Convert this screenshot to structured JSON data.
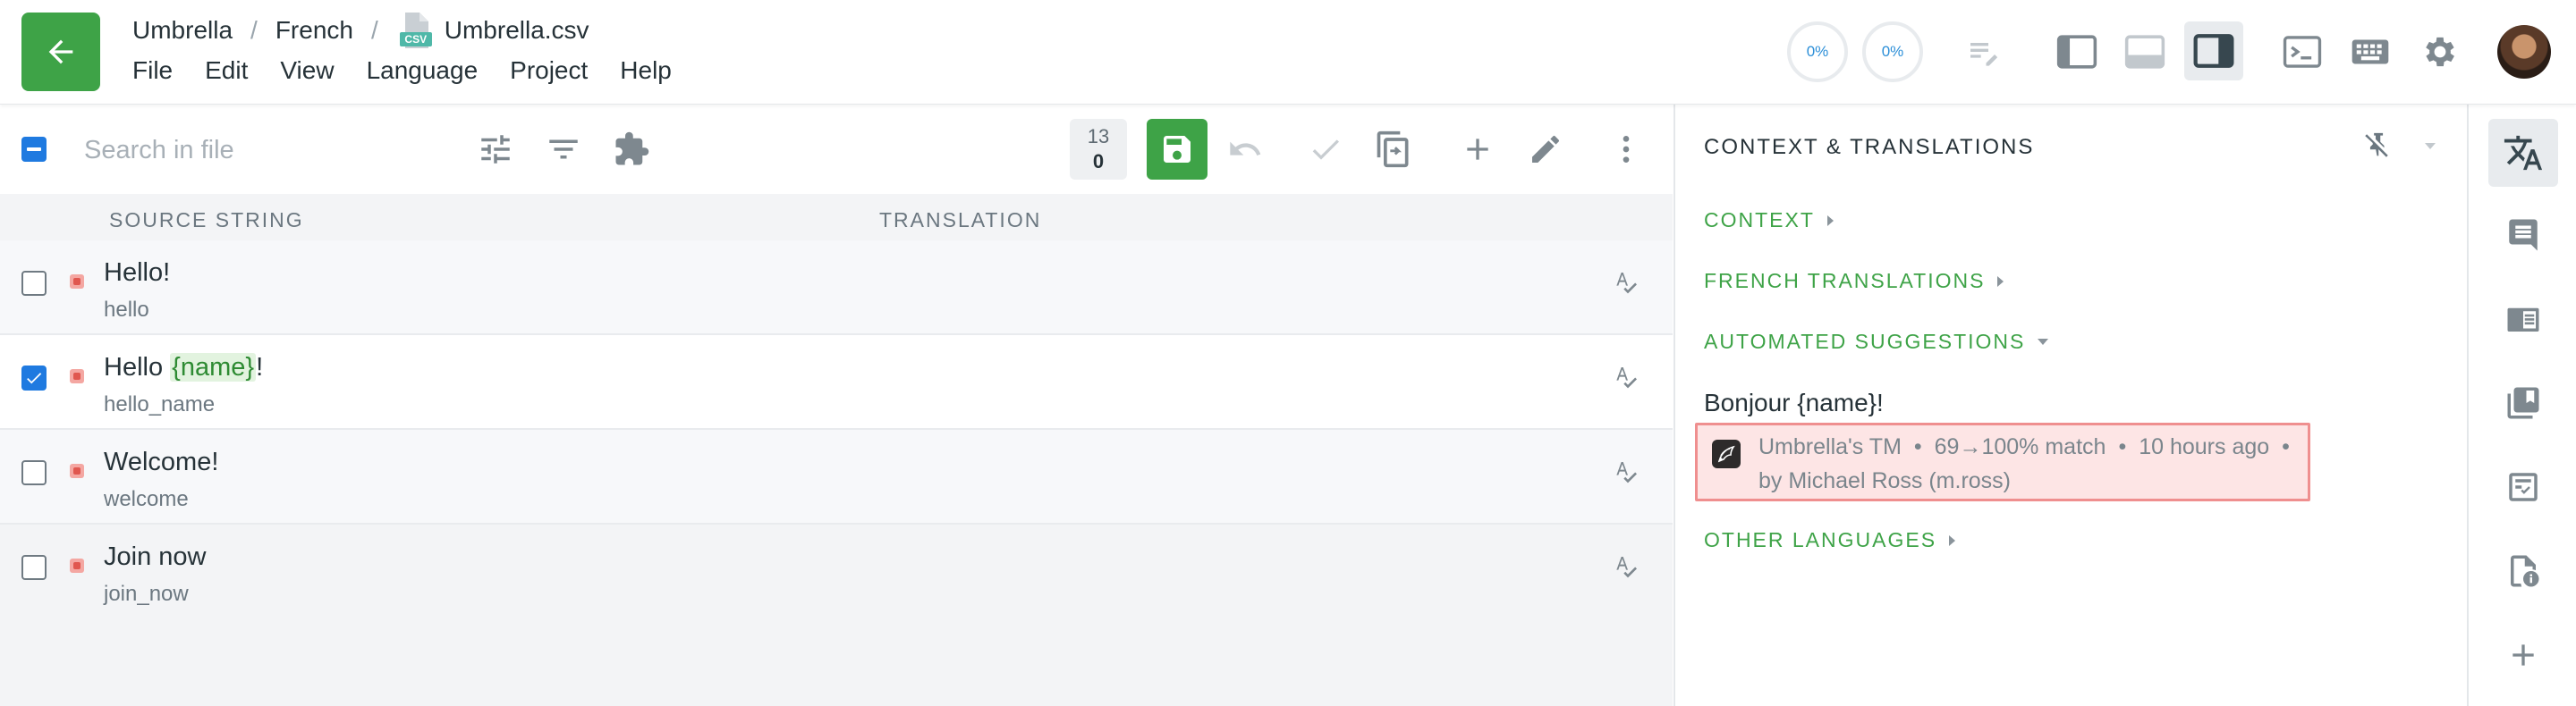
{
  "breadcrumb": {
    "project": "Umbrella",
    "language": "French",
    "file_badge": "CSV",
    "file": "Umbrella.csv"
  },
  "menu": [
    "File",
    "Edit",
    "View",
    "Language",
    "Project",
    "Help"
  ],
  "progress": [
    {
      "label": "0%",
      "value": 0
    },
    {
      "label": "0%",
      "value": 0
    }
  ],
  "search": {
    "placeholder": "Search in file"
  },
  "counter": {
    "top": "13",
    "bottom": "0"
  },
  "columns": {
    "source": "SOURCE STRING",
    "translation": "TRANSLATION"
  },
  "rows": [
    {
      "source": "Hello!",
      "key": "hello",
      "checked": false
    },
    {
      "source_parts": [
        "Hello ",
        "{name}",
        "!"
      ],
      "key": "hello_name",
      "checked": true
    },
    {
      "source": "Welcome!",
      "key": "welcome",
      "checked": false
    },
    {
      "source": "Join now",
      "key": "join_now",
      "checked": false
    }
  ],
  "panel": {
    "title": "CONTEXT & TRANSLATIONS",
    "sections": {
      "context": "CONTEXT",
      "french": "FRENCH TRANSLATIONS",
      "automated": "AUTOMATED SUGGESTIONS",
      "other": "OTHER LANGUAGES"
    },
    "suggestion": {
      "text": "Bonjour {name}!",
      "source": "Umbrella's TM",
      "match": "69→100% match",
      "time": "10 hours ago",
      "author": "by Michael Ross (m.ross)"
    }
  },
  "colors": {
    "accent_green": "#3ea347",
    "checkbox_blue": "#1f7ae0",
    "highlight_red": "#ef8f8f"
  }
}
